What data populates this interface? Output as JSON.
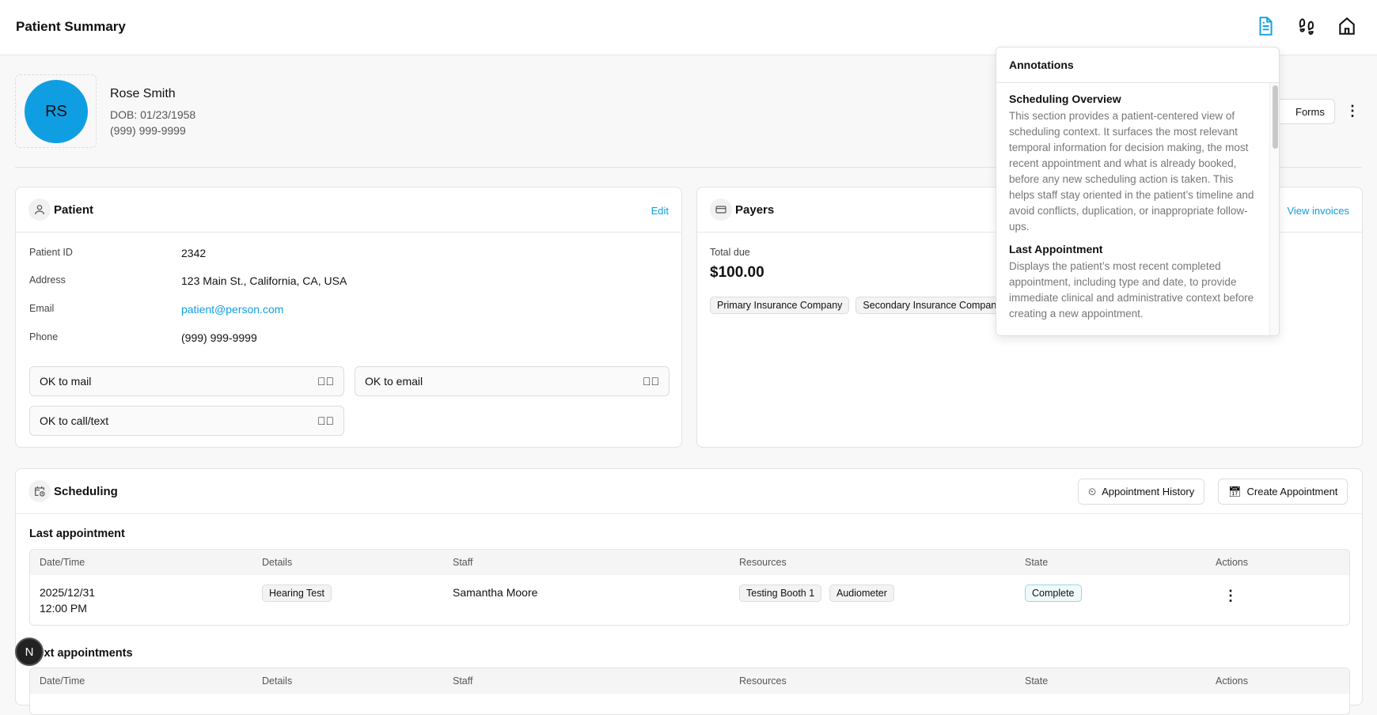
{
  "header": {
    "title": "Patient Summary",
    "icons": [
      "document-icon",
      "footprints-icon",
      "home-icon"
    ],
    "accent": "#109ee3"
  },
  "profile": {
    "initials": "RS",
    "name": "Rose Smith",
    "dob": "DOB: 01/23/1958",
    "phone": "(999) 999-9999",
    "forms_label": "Forms"
  },
  "patient": {
    "title": "Patient",
    "edit": "Edit",
    "fields": [
      {
        "label": "Patient ID",
        "value": "2342"
      },
      {
        "label": "Address",
        "value": "123 Main St., California, CA, USA"
      },
      {
        "label": "Email",
        "value": "patient@person.com"
      },
      {
        "label": "Phone",
        "value": "(999) 999-9999"
      }
    ],
    "consents": [
      "OK to mail",
      "OK to email",
      "OK to call/text"
    ]
  },
  "payers": {
    "title": "Payers",
    "view_invoices": "View invoices",
    "total_due_label": "Total due",
    "total_due": "$100.00",
    "insurers": [
      "Primary Insurance Company",
      "Secondary Insurance Company"
    ]
  },
  "scheduling": {
    "title": "Scheduling",
    "history_btn": "Appointment History",
    "create_btn": "Create Appointment",
    "last_title": "Last appointment",
    "next_title": "Next appointments",
    "columns": [
      "Date/Time",
      "Details",
      "Staff",
      "Resources",
      "State",
      "Actions"
    ],
    "last": {
      "date": "2025/12/31",
      "time": "12:00 PM",
      "details": "Hearing Test",
      "staff": "Samantha Moore",
      "resources": [
        "Testing Booth 1",
        "Audiometer"
      ],
      "state": "Complete"
    }
  },
  "annotations": {
    "title": "Annotations",
    "items": [
      {
        "heading": "Scheduling Overview",
        "body": "This section provides a patient-centered view of scheduling context. It surfaces the most relevant temporal information for decision making, the most recent appointment and what is already booked, before any new scheduling action is taken. This helps staff stay oriented in the patient’s timeline and avoid conflicts, duplication, or inappropriate follow-ups."
      },
      {
        "heading": "Last Appointment",
        "body": "Displays the patient’s most recent completed appointment, including type and date, to provide immediate clinical and administrative context before creating a new appointment."
      }
    ]
  },
  "dev_badge": "N"
}
